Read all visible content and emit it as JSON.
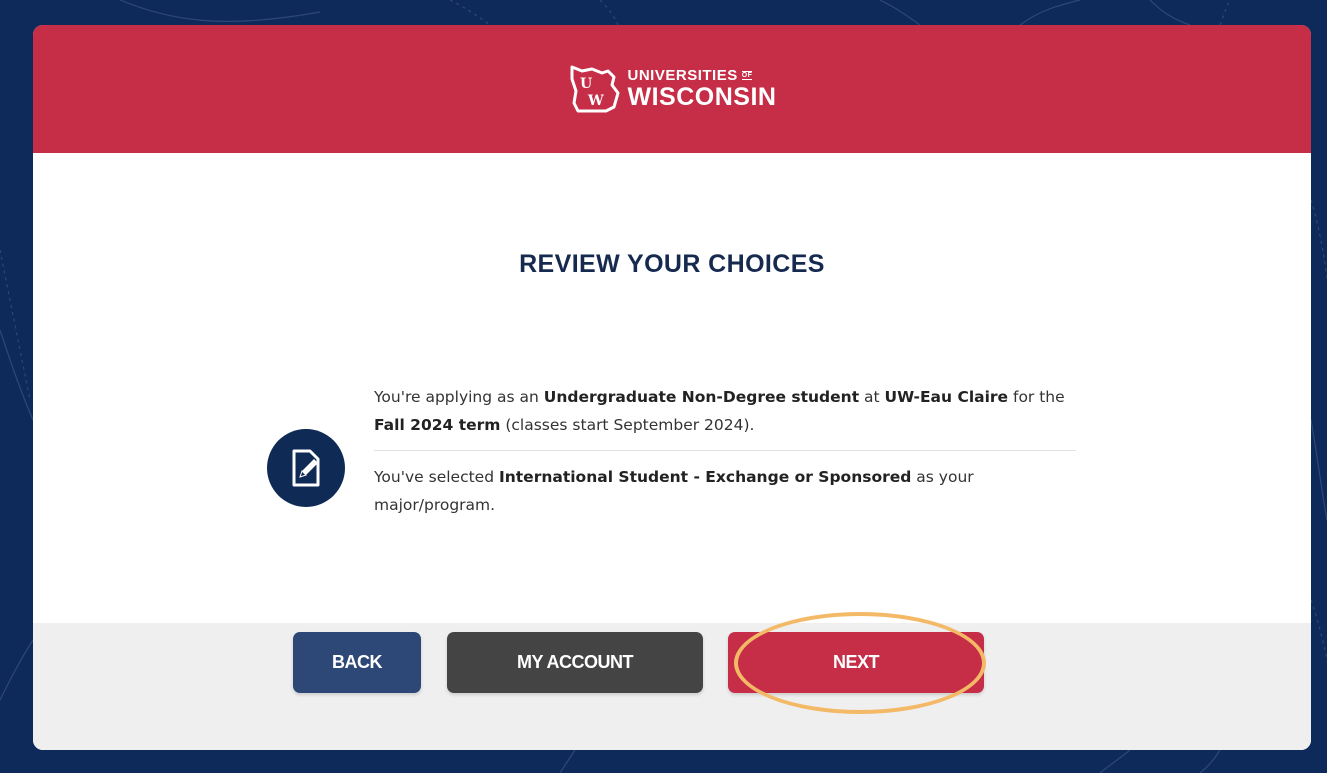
{
  "header": {
    "logo_top": "UNIVERSITIES",
    "logo_of": "OF",
    "logo_bottom": "WISCONSIN",
    "logo_mark": "UW"
  },
  "page": {
    "title": "REVIEW YOUR CHOICES"
  },
  "choices": {
    "icon": "edit-document-icon",
    "line1": {
      "t1": "You're applying as an ",
      "b1": "Undergraduate Non-Degree student",
      "t2": " at ",
      "b2": "UW-Eau Claire",
      "t3": " for the ",
      "b3": "Fall 2024 term",
      "t4": " (classes start September 2024)."
    },
    "line2": {
      "t1": "You've selected ",
      "b1": "International Student - Exchange or Sponsored",
      "t2": " as your major/program."
    }
  },
  "buttons": {
    "back": "BACK",
    "my_account": "MY ACCOUNT",
    "next": "NEXT"
  },
  "colors": {
    "header_red": "#c62d47",
    "navy": "#0f2a55",
    "back_blue": "#2d4776",
    "account_gray": "#444444",
    "highlight_orange": "#f4b966"
  }
}
